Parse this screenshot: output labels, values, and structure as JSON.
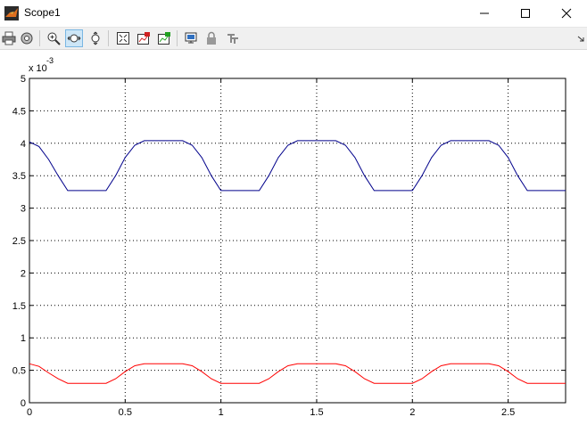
{
  "window": {
    "title": "Scope1",
    "app_icon": "matlab-icon",
    "controls": [
      "minimize-icon",
      "maximize-icon",
      "close-icon"
    ]
  },
  "toolbar": {
    "buttons": [
      {
        "name": "print-icon"
      },
      {
        "name": "parameters-icon"
      },
      {
        "name": "zoom-in-icon"
      },
      {
        "name": "zoom-x-icon",
        "active": true
      },
      {
        "name": "zoom-y-icon"
      },
      {
        "name": "autoscale-icon"
      },
      {
        "name": "save-axes-settings-icon"
      },
      {
        "name": "restore-axes-settings-icon"
      },
      {
        "name": "floating-scope-icon"
      },
      {
        "name": "lock-axes-icon"
      },
      {
        "name": "signal-selection-icon"
      }
    ],
    "overflow": "chevron-icon"
  },
  "chart_data": {
    "type": "line",
    "title": "",
    "xlabel": "",
    "ylabel": "",
    "exponent_label": "x 10",
    "exponent_power": "-3",
    "xlim": [
      0,
      2.8
    ],
    "ylim": [
      0,
      5
    ],
    "xticks": [
      "0",
      "0.5",
      "1",
      "1.5",
      "2",
      "2.5"
    ],
    "xtick_values": [
      0,
      0.5,
      1,
      1.5,
      2,
      2.5
    ],
    "yticks": [
      "0",
      "0.5",
      "1",
      "1.5",
      "2",
      "2.5",
      "3",
      "3.5",
      "4",
      "4.5",
      "5"
    ],
    "ytick_values": [
      0,
      0.5,
      1,
      1.5,
      2,
      2.5,
      3,
      3.5,
      4,
      4.5,
      5
    ],
    "grid": true,
    "series": [
      {
        "color": "#00008b",
        "x": [
          0,
          0.05,
          0.1,
          0.15,
          0.2,
          0.4,
          0.45,
          0.5,
          0.55,
          0.6,
          0.8,
          0.85,
          0.9,
          0.95,
          1.0,
          1.2,
          1.25,
          1.3,
          1.35,
          1.4,
          1.6,
          1.65,
          1.7,
          1.75,
          1.8,
          2.0,
          2.05,
          2.1,
          2.15,
          2.2,
          2.4,
          2.45,
          2.5,
          2.55,
          2.6,
          2.8
        ],
        "values": [
          4.02,
          3.95,
          3.75,
          3.5,
          3.27,
          3.27,
          3.5,
          3.78,
          3.97,
          4.04,
          4.04,
          3.97,
          3.78,
          3.5,
          3.27,
          3.27,
          3.5,
          3.78,
          3.97,
          4.04,
          4.04,
          3.97,
          3.78,
          3.5,
          3.27,
          3.27,
          3.5,
          3.78,
          3.97,
          4.04,
          4.04,
          3.97,
          3.78,
          3.5,
          3.27,
          3.27
        ]
      },
      {
        "color": "#ff0000",
        "x": [
          0,
          0.05,
          0.1,
          0.15,
          0.2,
          0.4,
          0.45,
          0.5,
          0.55,
          0.6,
          0.8,
          0.85,
          0.9,
          0.95,
          1.0,
          1.2,
          1.25,
          1.3,
          1.35,
          1.4,
          1.6,
          1.65,
          1.7,
          1.75,
          1.8,
          2.0,
          2.05,
          2.1,
          2.15,
          2.2,
          2.4,
          2.45,
          2.5,
          2.55,
          2.6,
          2.8
        ],
        "values": [
          0.6,
          0.56,
          0.46,
          0.37,
          0.3,
          0.3,
          0.37,
          0.48,
          0.57,
          0.6,
          0.6,
          0.57,
          0.48,
          0.37,
          0.3,
          0.3,
          0.37,
          0.48,
          0.57,
          0.6,
          0.6,
          0.57,
          0.48,
          0.37,
          0.3,
          0.3,
          0.37,
          0.48,
          0.57,
          0.6,
          0.6,
          0.57,
          0.48,
          0.37,
          0.3,
          0.3
        ]
      }
    ]
  }
}
